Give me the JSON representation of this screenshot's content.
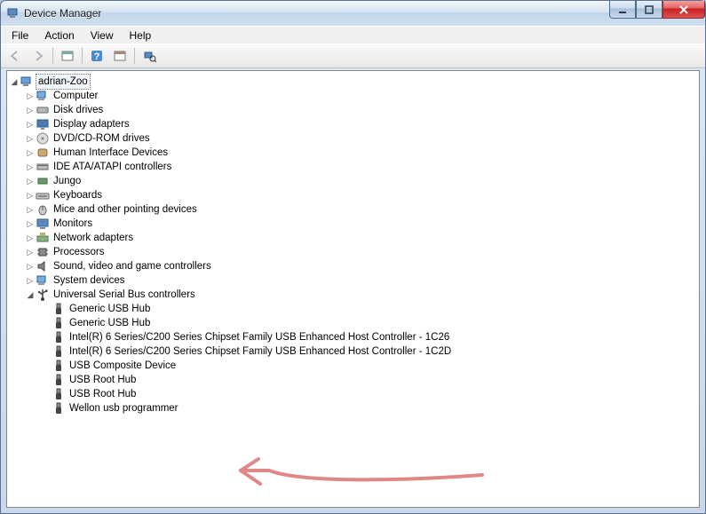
{
  "window": {
    "title": "Device Manager"
  },
  "menu": {
    "file": "File",
    "action": "Action",
    "view": "View",
    "help": "Help"
  },
  "toolbar_icons": {
    "back": "back-arrow-icon",
    "forward": "forward-arrow-icon",
    "show_hidden": "show-hidden-icon",
    "help": "help-icon",
    "properties": "properties-icon",
    "scan": "scan-hardware-icon"
  },
  "tree": {
    "root": "adrian-Zoo",
    "categories": [
      {
        "label": "Computer",
        "icon": "computer-icon",
        "expanded": false
      },
      {
        "label": "Disk drives",
        "icon": "disk-icon",
        "expanded": false
      },
      {
        "label": "Display adapters",
        "icon": "display-icon",
        "expanded": false
      },
      {
        "label": "DVD/CD-ROM drives",
        "icon": "dvd-icon",
        "expanded": false
      },
      {
        "label": "Human Interface Devices",
        "icon": "hid-icon",
        "expanded": false
      },
      {
        "label": "IDE ATA/ATAPI controllers",
        "icon": "ide-icon",
        "expanded": false
      },
      {
        "label": "Jungo",
        "icon": "jungo-icon",
        "expanded": false
      },
      {
        "label": "Keyboards",
        "icon": "keyboard-icon",
        "expanded": false
      },
      {
        "label": "Mice and other pointing devices",
        "icon": "mouse-icon",
        "expanded": false
      },
      {
        "label": "Monitors",
        "icon": "monitor-icon",
        "expanded": false
      },
      {
        "label": "Network adapters",
        "icon": "network-icon",
        "expanded": false
      },
      {
        "label": "Processors",
        "icon": "processor-icon",
        "expanded": false
      },
      {
        "label": "Sound, video and game controllers",
        "icon": "sound-icon",
        "expanded": false
      },
      {
        "label": "System devices",
        "icon": "system-icon",
        "expanded": false
      },
      {
        "label": "Universal Serial Bus controllers",
        "icon": "usb-icon",
        "expanded": true,
        "children": [
          {
            "label": "Generic USB Hub",
            "icon": "usb-device-icon"
          },
          {
            "label": "Generic USB Hub",
            "icon": "usb-device-icon"
          },
          {
            "label": "Intel(R) 6 Series/C200 Series Chipset Family USB Enhanced Host Controller - 1C26",
            "icon": "usb-device-icon"
          },
          {
            "label": "Intel(R) 6 Series/C200 Series Chipset Family USB Enhanced Host Controller - 1C2D",
            "icon": "usb-device-icon"
          },
          {
            "label": "USB Composite Device",
            "icon": "usb-device-icon"
          },
          {
            "label": "USB Root Hub",
            "icon": "usb-device-icon"
          },
          {
            "label": "USB Root Hub",
            "icon": "usb-device-icon"
          },
          {
            "label": "Wellon usb programmer",
            "icon": "usb-device-icon"
          }
        ]
      }
    ]
  },
  "annotation": {
    "arrow_color": "#e08888"
  }
}
